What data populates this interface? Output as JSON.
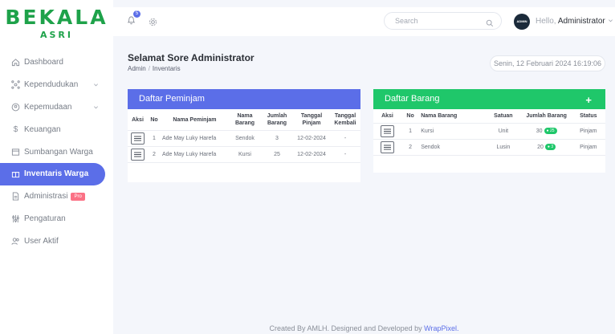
{
  "brand": {
    "name": "BEKALA",
    "sub": "ASRI"
  },
  "sidebar": {
    "items": [
      {
        "label": "Dashboard"
      },
      {
        "label": "Kependudukan"
      },
      {
        "label": "Kepemudaan"
      },
      {
        "label": "Keuangan"
      },
      {
        "label": "Sumbangan Warga"
      },
      {
        "label": "Inventaris Warga"
      },
      {
        "label": "Administrasi",
        "badge": "Pro"
      },
      {
        "label": "Pengaturan"
      },
      {
        "label": "User Aktif"
      }
    ]
  },
  "topbar": {
    "notification_count": "5",
    "search_placeholder": "Search",
    "avatar_text": "ADMIN",
    "hello_prefix": "Hello,",
    "user_name": "Administrator"
  },
  "page": {
    "greeting": "Selamat Sore Administrator",
    "breadcrumb": [
      "Admin",
      "Inventaris"
    ],
    "datetime": "Senin, 12 Februari 2024 16:19:06"
  },
  "peminjam": {
    "title": "Daftar Peminjam",
    "headers": [
      "Aksi",
      "No",
      "Nama Peminjam",
      "Nama Barang",
      "Jumlah Barang",
      "Tanggal Pinjam",
      "Tanggal Kembali"
    ],
    "rows": [
      {
        "no": "1",
        "nama": "Ade May Luky Harefa",
        "barang": "Sendok",
        "jumlah": "3",
        "pinjam": "12-02-2024",
        "kembali": "-"
      },
      {
        "no": "2",
        "nama": "Ade May Luky Harefa",
        "barang": "Kursi",
        "jumlah": "25",
        "pinjam": "12-02-2024",
        "kembali": "-"
      }
    ]
  },
  "barang": {
    "title": "Daftar Barang",
    "add_label": "+",
    "headers": [
      "Aksi",
      "No",
      "Nama Barang",
      "Satuan",
      "Jumlah Barang",
      "Status"
    ],
    "rows": [
      {
        "no": "1",
        "nama": "Kursi",
        "satuan": "Unit",
        "jumlah": "30",
        "pill": "25",
        "status": "Pinjam"
      },
      {
        "no": "2",
        "nama": "Sendok",
        "satuan": "Lusin",
        "jumlah": "20",
        "pill": "3",
        "status": "Pinjam"
      }
    ]
  },
  "footer": {
    "text": "Created By AMLH. Designed and Developed by",
    "link": "WrapPixel."
  },
  "colors": {
    "accent": "#5b6ee8",
    "success": "#1fc76a",
    "brand": "#1ea24a",
    "badge": "#fb7185"
  }
}
